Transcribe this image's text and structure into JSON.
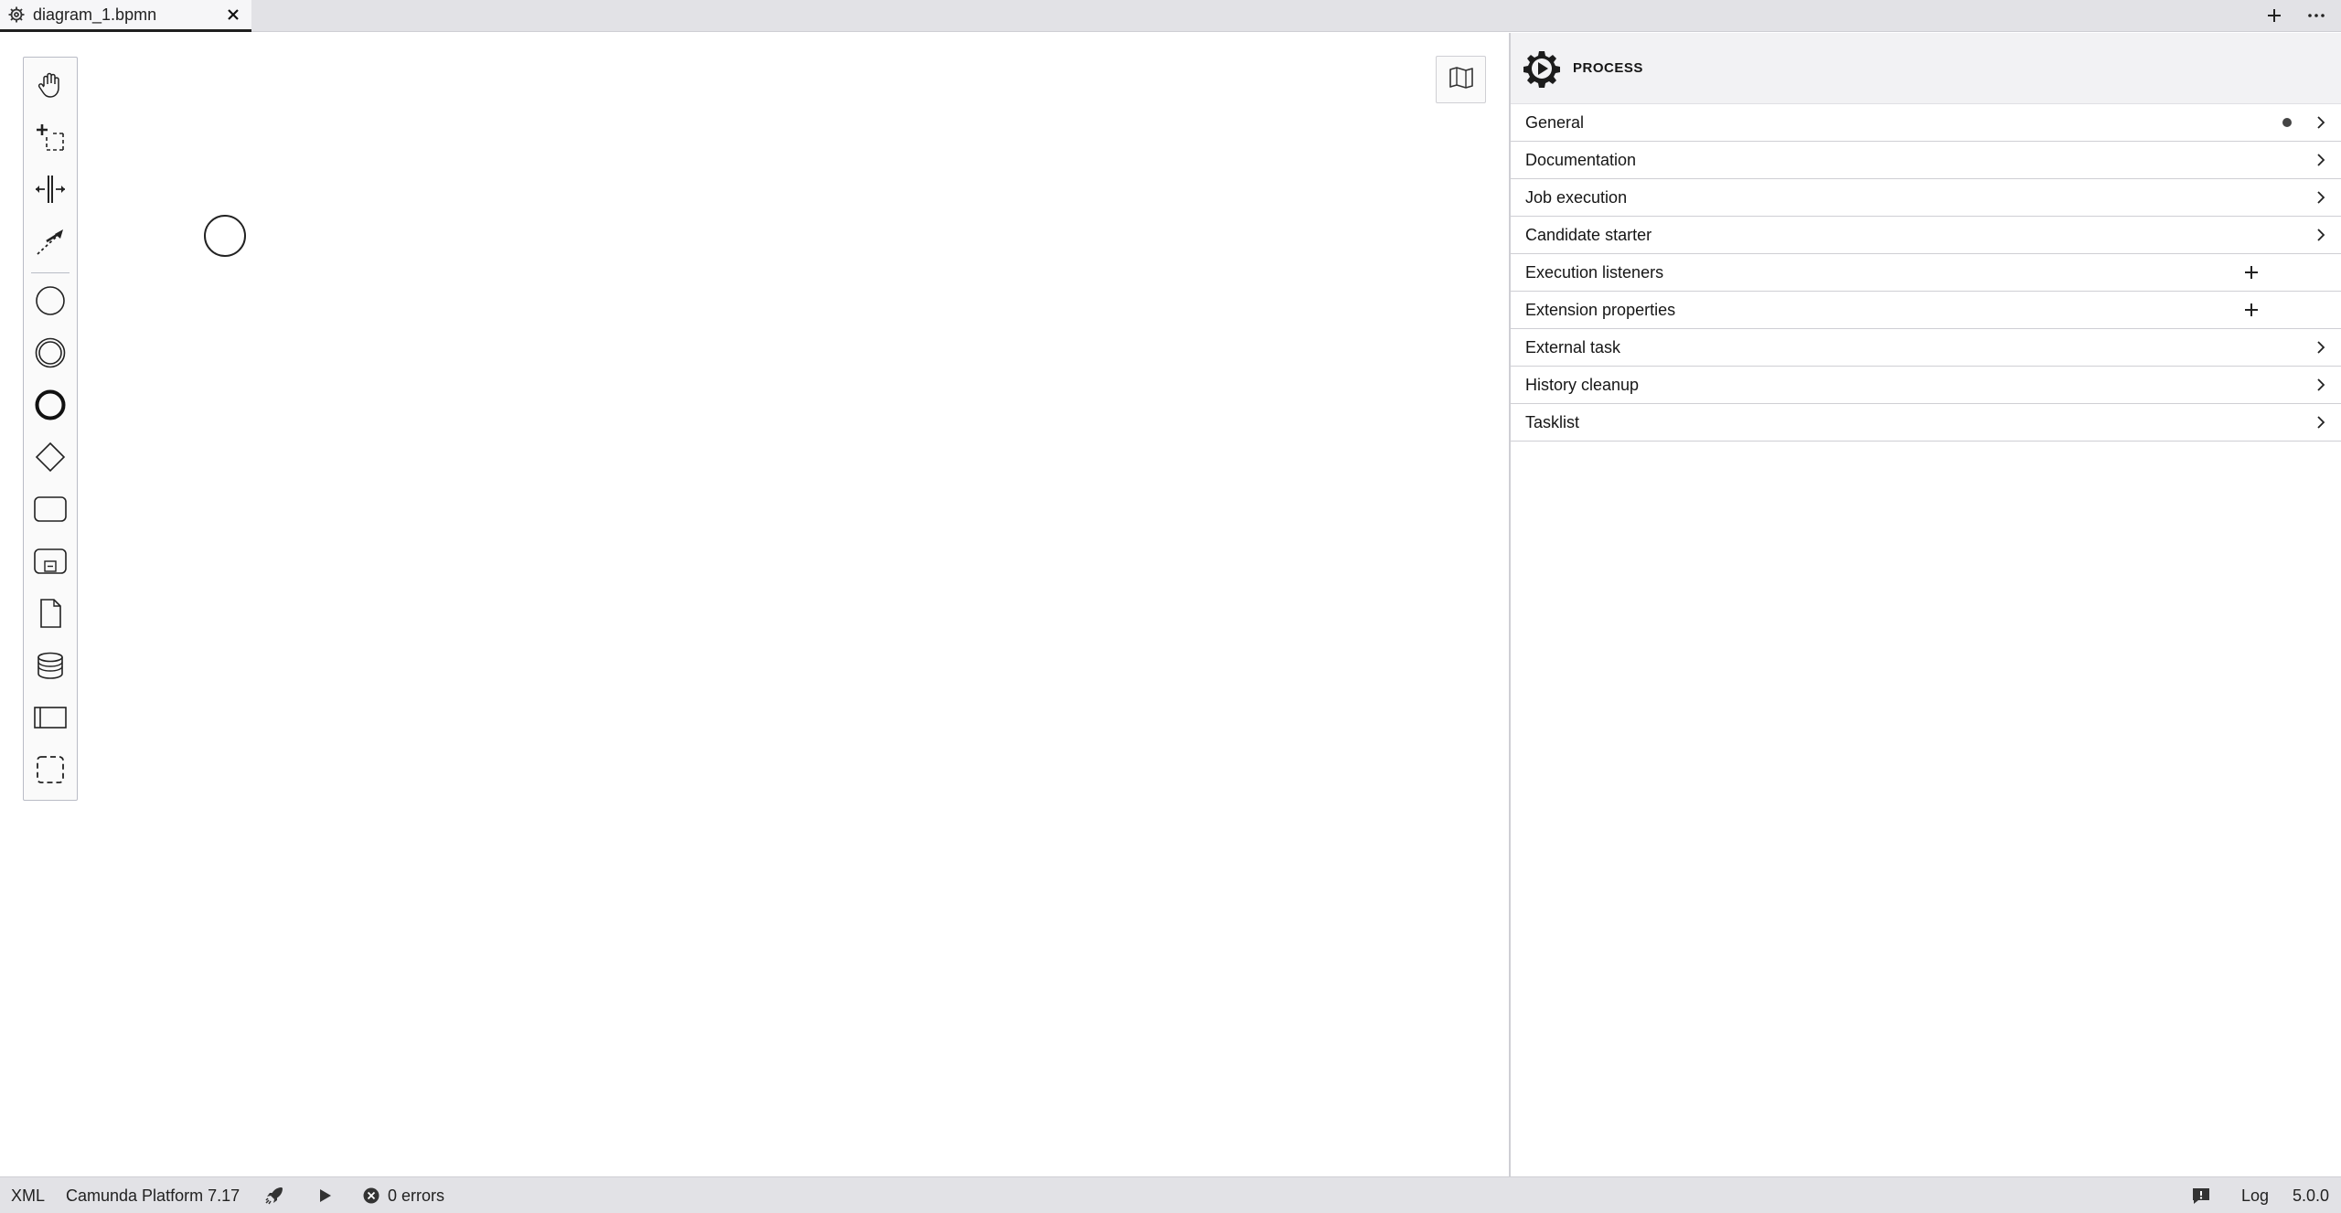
{
  "tabs": [
    {
      "title": "diagram_1.bpmn",
      "icon": "gear-icon",
      "active": true
    }
  ],
  "tabbar": {
    "add_icon": "plus-icon",
    "more_icon": "ellipsis-icon"
  },
  "palette": {
    "tools": [
      {
        "name": "hand-tool",
        "icon": "hand-icon"
      },
      {
        "name": "lasso-tool",
        "icon": "lasso-icon"
      },
      {
        "name": "space-tool",
        "icon": "space-icon"
      },
      {
        "name": "global-connect-tool",
        "icon": "connect-icon"
      },
      {
        "name": "create-start-event",
        "icon": "start-event-icon"
      },
      {
        "name": "create-intermediate-event",
        "icon": "intermediate-event-icon"
      },
      {
        "name": "create-end-event",
        "icon": "end-event-icon"
      },
      {
        "name": "create-gateway",
        "icon": "gateway-icon"
      },
      {
        "name": "create-task",
        "icon": "task-icon"
      },
      {
        "name": "create-subprocess",
        "icon": "subprocess-icon"
      },
      {
        "name": "create-data-object",
        "icon": "data-object-icon"
      },
      {
        "name": "create-data-store",
        "icon": "data-store-icon"
      },
      {
        "name": "create-pool",
        "icon": "pool-icon"
      },
      {
        "name": "create-group",
        "icon": "group-icon"
      }
    ]
  },
  "canvas": {
    "minimap_icon": "map-icon",
    "elements": [
      {
        "type": "start-event"
      }
    ]
  },
  "properties": {
    "header": {
      "title": "PROCESS",
      "icon": "process-icon"
    },
    "groups": [
      {
        "label": "General",
        "indicator": true,
        "action": "chevron"
      },
      {
        "label": "Documentation",
        "indicator": false,
        "action": "chevron"
      },
      {
        "label": "Job execution",
        "indicator": false,
        "action": "chevron"
      },
      {
        "label": "Candidate starter",
        "indicator": false,
        "action": "chevron"
      },
      {
        "label": "Execution listeners",
        "indicator": false,
        "action": "add"
      },
      {
        "label": "Extension properties",
        "indicator": false,
        "action": "add"
      },
      {
        "label": "External task",
        "indicator": false,
        "action": "chevron"
      },
      {
        "label": "History cleanup",
        "indicator": false,
        "action": "chevron"
      },
      {
        "label": "Tasklist",
        "indicator": false,
        "action": "chevron"
      }
    ]
  },
  "statusbar": {
    "xml_label": "XML",
    "platform_label": "Camunda Platform 7.17",
    "errors_label": "0 errors",
    "log_label": "Log",
    "version": "5.0.0"
  }
}
